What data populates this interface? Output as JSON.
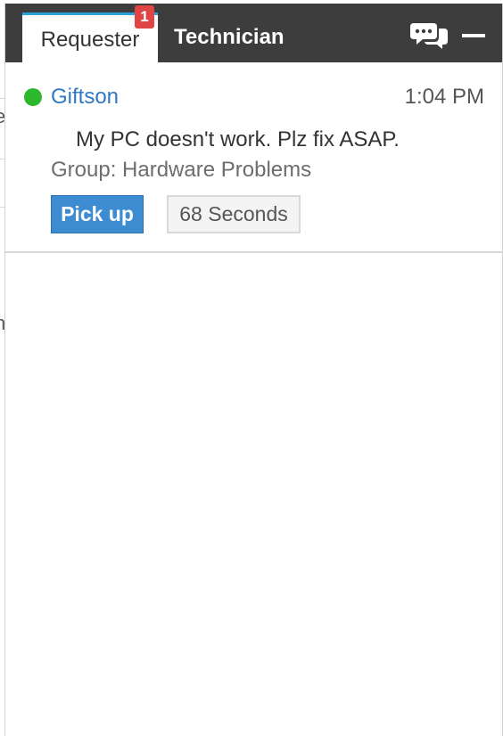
{
  "tabs": {
    "requester_label": "Requester",
    "requester_badge": "1",
    "technician_label": "Technician"
  },
  "header_icons": {
    "chat": "chat-bubbles-icon",
    "minimize": "minimize-icon"
  },
  "request": {
    "name": "Giftson",
    "time": "1:04 PM",
    "message": "My PC doesn't work. Plz fix ASAP.",
    "group": "Group: Hardware Problems",
    "pickup_label": "Pick up",
    "timer": "68 Seconds",
    "status_color": "#2eb82e"
  },
  "background_fragments": [
    "e",
    "n"
  ],
  "colors": {
    "header": "#3d3d3d",
    "tab_accent": "#2a9fd8",
    "badge": "#e04545",
    "link": "#2f78c4",
    "button": "#3d8bd0"
  }
}
